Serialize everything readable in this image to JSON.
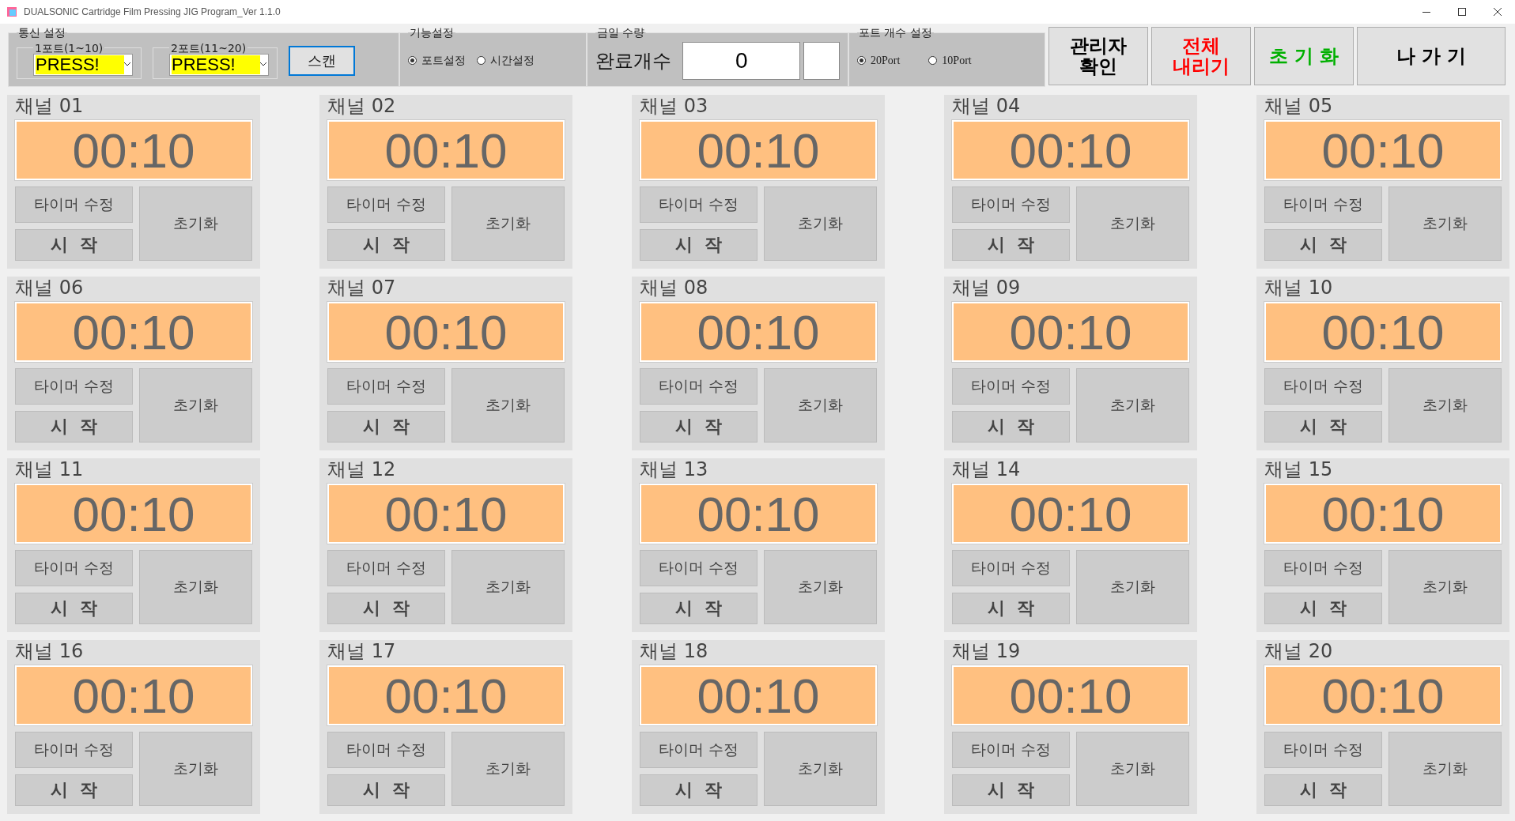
{
  "window": {
    "title": "DUALSONIC Cartridge Film Pressing JIG Program_Ver 1.1.0"
  },
  "comm": {
    "title": "통신 설정",
    "ports": [
      {
        "label": "1포트(1~10)",
        "value": "PRESS!"
      },
      {
        "label": "2포트(11~20)",
        "value": "PRESS!"
      }
    ],
    "scan": "스캔"
  },
  "function": {
    "title": "기능설정",
    "options": [
      {
        "label": "포트설정",
        "selected": true
      },
      {
        "label": "시간설정",
        "selected": false
      }
    ]
  },
  "today": {
    "title": "금일 수량",
    "label": "완료개수",
    "value": "0"
  },
  "port_count": {
    "title": "포트 개수 설정",
    "options": [
      {
        "label": "20Port",
        "selected": true
      },
      {
        "label": "10Port",
        "selected": false
      }
    ]
  },
  "buttons": [
    {
      "label": "관리자\n확인",
      "color": "#000000"
    },
    {
      "label": "전체\n내리기",
      "color": "#ff0000"
    },
    {
      "label": "초 기 화",
      "color": "#00b000"
    },
    {
      "label": "나 가 기",
      "color": "#000000"
    }
  ],
  "channels": [
    {
      "name": "채널 01",
      "time": "00:10",
      "edit": "타이머 수정",
      "start": "시  작",
      "reset": "초기화"
    },
    {
      "name": "채널 02",
      "time": "00:10",
      "edit": "타이머 수정",
      "start": "시  작",
      "reset": "초기화"
    },
    {
      "name": "채널 03",
      "time": "00:10",
      "edit": "타이머 수정",
      "start": "시  작",
      "reset": "초기화"
    },
    {
      "name": "채널 04",
      "time": "00:10",
      "edit": "타이머 수정",
      "start": "시  작",
      "reset": "초기화"
    },
    {
      "name": "채널 05",
      "time": "00:10",
      "edit": "타이머 수정",
      "start": "시  작",
      "reset": "초기화"
    },
    {
      "name": "채널 06",
      "time": "00:10",
      "edit": "타이머 수정",
      "start": "시  작",
      "reset": "초기화"
    },
    {
      "name": "채널 07",
      "time": "00:10",
      "edit": "타이머 수정",
      "start": "시  작",
      "reset": "초기화"
    },
    {
      "name": "채널 08",
      "time": "00:10",
      "edit": "타이머 수정",
      "start": "시  작",
      "reset": "초기화"
    },
    {
      "name": "채널 09",
      "time": "00:10",
      "edit": "타이머 수정",
      "start": "시  작",
      "reset": "초기화"
    },
    {
      "name": "채널 10",
      "time": "00:10",
      "edit": "타이머 수정",
      "start": "시  작",
      "reset": "초기화"
    },
    {
      "name": "채널 11",
      "time": "00:10",
      "edit": "타이머 수정",
      "start": "시  작",
      "reset": "초기화"
    },
    {
      "name": "채널 12",
      "time": "00:10",
      "edit": "타이머 수정",
      "start": "시  작",
      "reset": "초기화"
    },
    {
      "name": "채널 13",
      "time": "00:10",
      "edit": "타이머 수정",
      "start": "시  작",
      "reset": "초기화"
    },
    {
      "name": "채널 14",
      "time": "00:10",
      "edit": "타이머 수정",
      "start": "시  작",
      "reset": "초기화"
    },
    {
      "name": "채널 15",
      "time": "00:10",
      "edit": "타이머 수정",
      "start": "시  작",
      "reset": "초기화"
    },
    {
      "name": "채널 16",
      "time": "00:10",
      "edit": "타이머 수정",
      "start": "시  작",
      "reset": "초기화"
    },
    {
      "name": "채널 17",
      "time": "00:10",
      "edit": "타이머 수정",
      "start": "시  작",
      "reset": "초기화"
    },
    {
      "name": "채널 18",
      "time": "00:10",
      "edit": "타이머 수정",
      "start": "시  작",
      "reset": "초기화"
    },
    {
      "name": "채널 19",
      "time": "00:10",
      "edit": "타이머 수정",
      "start": "시  작",
      "reset": "초기화"
    },
    {
      "name": "채널 20",
      "time": "00:10",
      "edit": "타이머 수정",
      "start": "시  작",
      "reset": "초기화"
    }
  ]
}
